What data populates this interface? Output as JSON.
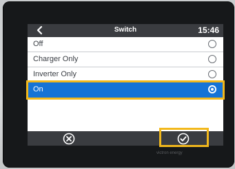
{
  "header": {
    "title": "Switch",
    "time": "15:46"
  },
  "options": [
    {
      "label": "Off",
      "selected": false
    },
    {
      "label": "Charger Only",
      "selected": false
    },
    {
      "label": "Inverter Only",
      "selected": false
    },
    {
      "label": "On",
      "selected": true
    }
  ],
  "icons": {
    "back": "chevron-left-icon",
    "cancel": "cancel-x-icon",
    "confirm": "checkmark-icon",
    "radio": "radio-button-icon"
  },
  "brand": "victron energy",
  "colors": {
    "selected_row": "#1573d6",
    "bar": "#3a3c40",
    "highlight": "#f2b81c"
  }
}
